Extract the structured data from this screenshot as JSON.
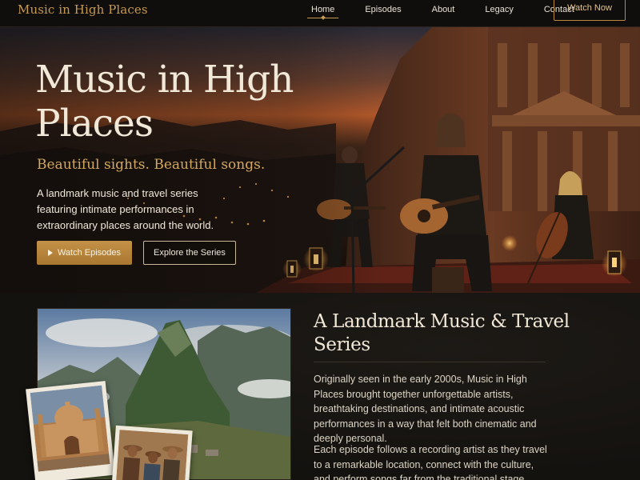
{
  "brand": {
    "name": "Music in High Places"
  },
  "nav": {
    "items": [
      {
        "label": "Home",
        "active": true
      },
      {
        "label": "Episodes",
        "active": false
      },
      {
        "label": "About",
        "active": false
      },
      {
        "label": "Legacy",
        "active": false
      },
      {
        "label": "Contact",
        "active": false
      }
    ],
    "cta_label": "Watch Now"
  },
  "hero": {
    "title": "Music in High Places",
    "subtitle": "Beautiful sights. Beautiful songs.",
    "description": "A landmark music and travel series featuring intimate performances in extraordinary places around the world.",
    "primary_button": {
      "label": "Watch Episodes",
      "icon": "play-icon"
    },
    "secondary_button": {
      "label": "Explore the Series"
    }
  },
  "about": {
    "title": "A Landmark Music & Travel Series",
    "paragraphs": [
      "Originally seen in the early 2000s, Music in High Places brought together unforgettable artists, breathtaking destinations, and intimate acoustic performances in a way that felt both cinematic and deeply personal.",
      "Each episode follows a recording artist as they travel to a remarkable location, connect with the culture, and perform songs far from the traditional stage."
    ]
  },
  "colors": {
    "accent": "#c79a52",
    "background": "#141210",
    "text": "#efe6d6"
  }
}
